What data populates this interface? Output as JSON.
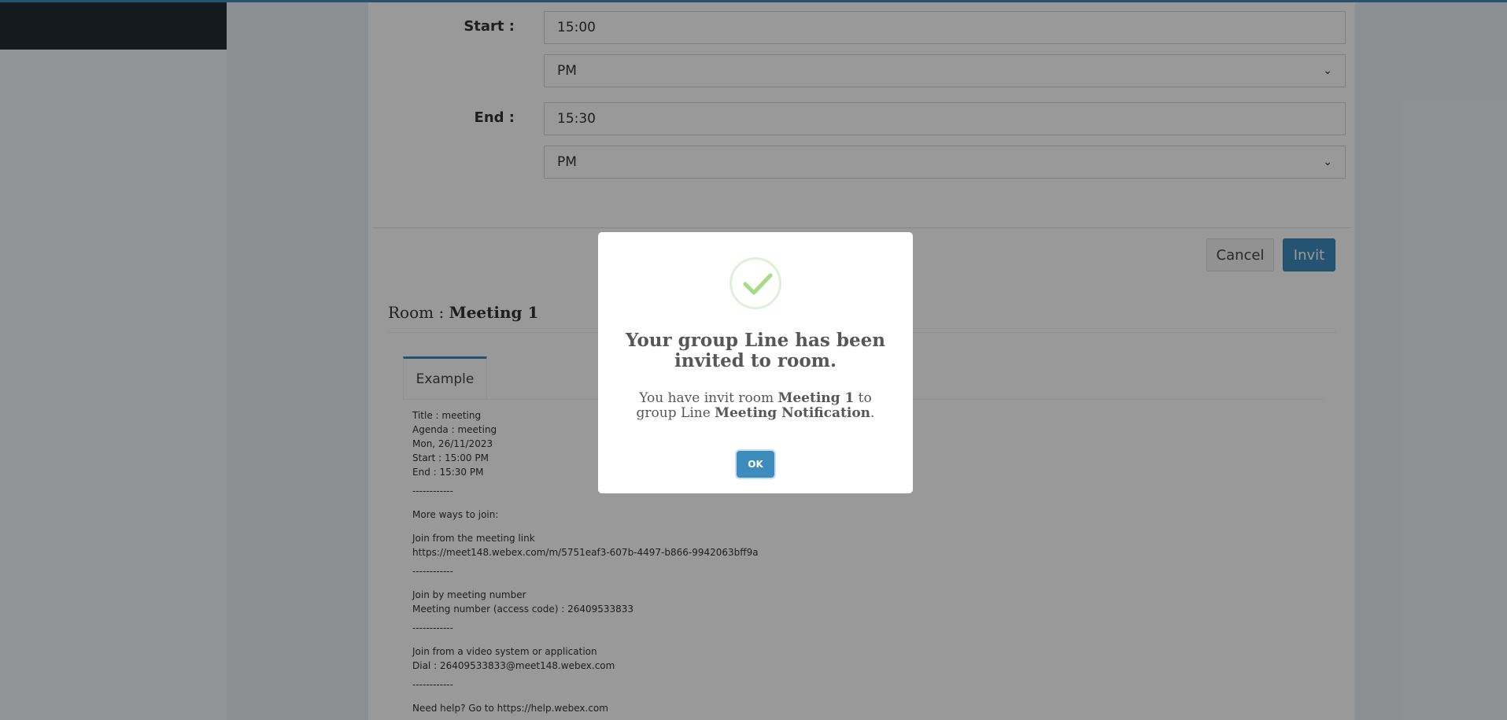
{
  "form": {
    "start_label": "Start :",
    "start_time": "15:00",
    "start_period": "PM",
    "end_label": "End :",
    "end_time": "15:30",
    "end_period": "PM"
  },
  "actions": {
    "cancel_label": "Cancel",
    "invit_label": "Invit"
  },
  "room": {
    "prefix": "Room : ",
    "name": "Meeting 1"
  },
  "tabs": [
    {
      "label": "Example",
      "active": true
    }
  ],
  "example_lines": {
    "title": "Title : meeting",
    "agenda": "Agenda : meeting",
    "date": "Mon, 26/11/2023",
    "start": "Start : 15:00 PM",
    "end": "End : 15:30 PM",
    "sep1": "------------",
    "more_ways": "More ways to join:",
    "link_heading": "Join from the meeting link",
    "link_url": "https://meet148.webex.com/m/5751eaf3-607b-4497-b866-9942063bff9a",
    "sep2": "------------",
    "number_heading": "Join by meeting number",
    "number_value": "Meeting number (access code) : 26409533833",
    "sep3": "------------",
    "video_heading": "Join from a video system or application",
    "video_dial": "Dial : 26409533833@meet148.webex.com",
    "sep4": "------------",
    "help": "Need help? Go to https://help.webex.com"
  },
  "modal": {
    "icon": "success-check-icon",
    "title": "Your group Line has been invited to room.",
    "text_part1": "You have invit room ",
    "text_room": "Meeting 1",
    "text_part2": " to group Line ",
    "text_group": "Meeting Notification",
    "text_part3": ".",
    "ok_label": "OK"
  },
  "colors": {
    "accent": "#3c8dbc",
    "sidebar": "#222d32",
    "success": "#a5dc86"
  }
}
